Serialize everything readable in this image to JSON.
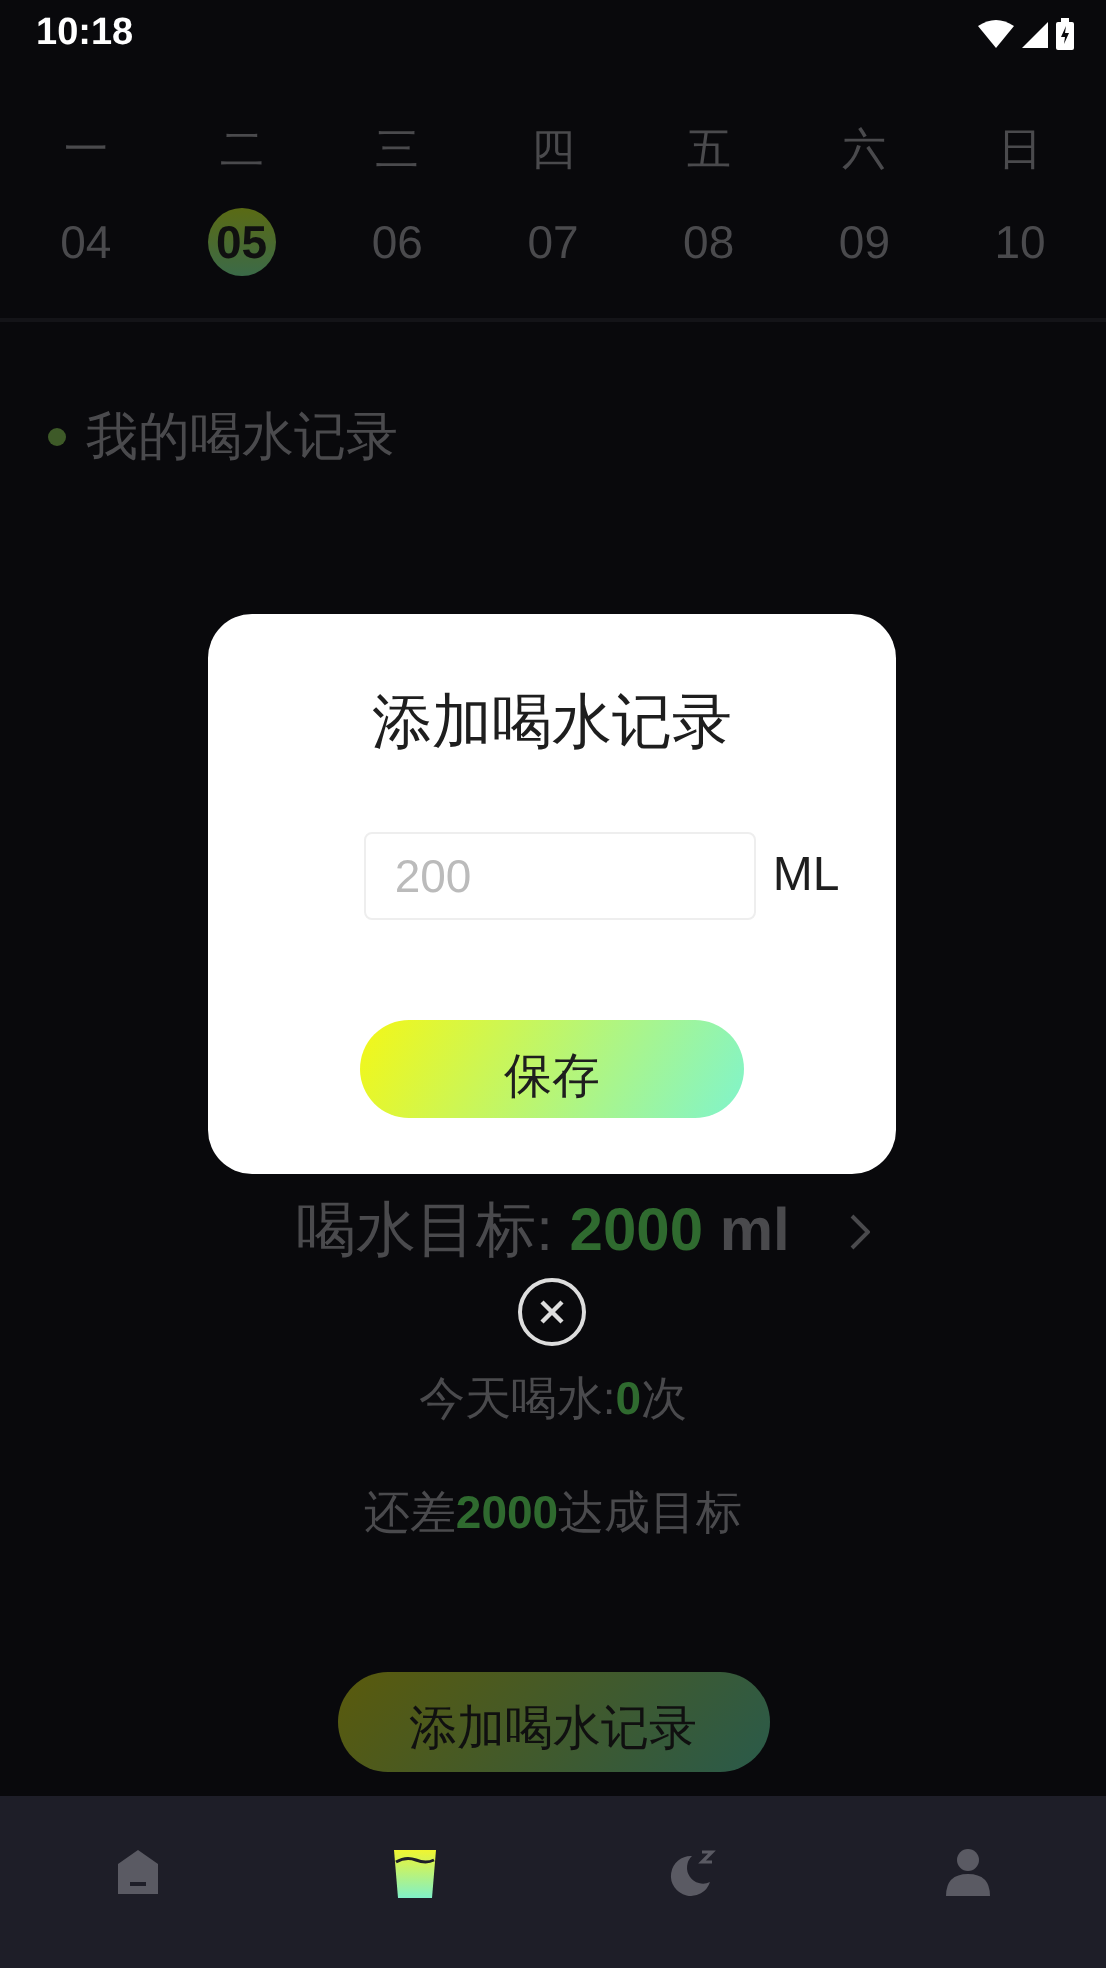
{
  "status_bar": {
    "time": "10:18"
  },
  "week": [
    {
      "weekday": "一",
      "date": "04",
      "selected": false
    },
    {
      "weekday": "二",
      "date": "05",
      "selected": true
    },
    {
      "weekday": "三",
      "date": "06",
      "selected": false
    },
    {
      "weekday": "四",
      "date": "07",
      "selected": false
    },
    {
      "weekday": "五",
      "date": "08",
      "selected": false
    },
    {
      "weekday": "六",
      "date": "09",
      "selected": false
    },
    {
      "weekday": "日",
      "date": "10",
      "selected": false
    }
  ],
  "section_title": "我的喝水记录",
  "goal": {
    "label": "喝水目标:",
    "value": "2000",
    "unit": "ml"
  },
  "today": {
    "prefix": "今天喝水:",
    "count": "0",
    "suffix": "次"
  },
  "remaining": {
    "prefix": "还差",
    "amount": "2000",
    "suffix": "达成目标"
  },
  "add_button": "添加喝水记录",
  "nav": [
    {
      "kind": "home",
      "selected": false
    },
    {
      "kind": "water",
      "selected": true
    },
    {
      "kind": "sleep",
      "selected": false
    },
    {
      "kind": "profile",
      "selected": false
    }
  ],
  "dialog": {
    "title": "添加喝水记录",
    "amount_field": {
      "placeholder": "200"
    },
    "unit": "ML",
    "save_button": "保存"
  }
}
